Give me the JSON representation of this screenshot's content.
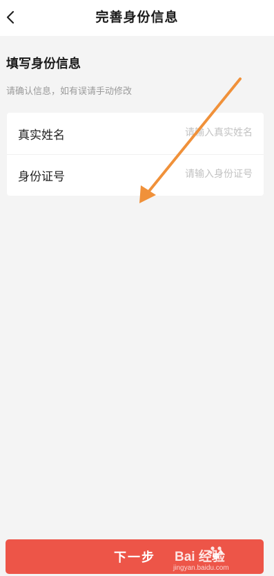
{
  "header": {
    "title": "完善身份信息",
    "back_icon": "chevron-left-icon"
  },
  "section": {
    "title": "填写身份信息",
    "hint": "请确认信息，如有误请手动修改"
  },
  "form": {
    "fields": [
      {
        "label": "真实姓名",
        "value": "",
        "placeholder": "请输入真实姓名"
      },
      {
        "label": "身份证号",
        "value": "",
        "placeholder": "请输入身份证号"
      }
    ]
  },
  "footer": {
    "next_label": "下一步"
  },
  "annotation": {
    "arrow_color": "#f0913a"
  },
  "watermark": {
    "brand": "Bai  经验",
    "sub": "jingyan.baidu.com"
  },
  "colors": {
    "accent": "#ed5548",
    "background": "#f4f4f4"
  }
}
